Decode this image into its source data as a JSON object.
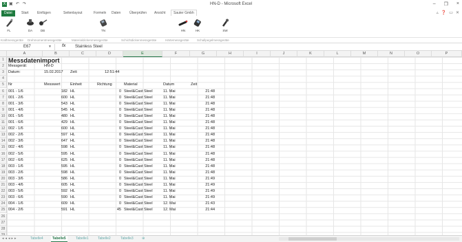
{
  "window": {
    "title": "HN-D - Microsoft Excel",
    "controls": [
      "–",
      "❐",
      "×"
    ]
  },
  "ribbon": {
    "tabs": [
      "Datei",
      "Start",
      "Einfügen",
      "Seitenlayout",
      "Formeln",
      "Daten",
      "Überprüfen",
      "Ansicht",
      "Sauter Gmbh"
    ],
    "buttons": [
      "FL",
      "DA",
      "DB",
      "TN",
      "HN",
      "HK",
      "SW"
    ],
    "groups": [
      "Kraftmessgeräte",
      "Drehmomentmessgeräte",
      "Materialdickenmessgeräte",
      "Schichtdickenmessgeräte",
      "Härtemessgeräte",
      "Schallpegelmessgeräte"
    ]
  },
  "formula_bar": {
    "namebox": "E67",
    "fx": "fx",
    "content": "Stainless Steel"
  },
  "columns": [
    "A",
    "B",
    "C",
    "D",
    "E",
    "F",
    "G",
    "H",
    "I",
    "J",
    "K",
    "L",
    "M",
    "N",
    "O",
    "P"
  ],
  "sheet": {
    "title": "Messdatenimport",
    "device_label": "Messgerät:",
    "device": "HN-D",
    "date_label": "Datum:",
    "date": "15.02.2017",
    "time_label": "Zeit:",
    "time": "12:51:44",
    "headers": [
      "Nr",
      "Messwert",
      "Einheit",
      "Richtung",
      "Material",
      "Datum",
      "Zeit"
    ],
    "rows": [
      [
        "001 - 1/6",
        "182",
        "HL",
        "0",
        "Steel&Cast Steel",
        "11. Mai",
        "21:48"
      ],
      [
        "001 - 2/6",
        "600",
        "HL",
        "0",
        "Steel&Cast Steel",
        "11. Mai",
        "21:48"
      ],
      [
        "001 - 3/6",
        "543",
        "HL",
        "0",
        "Steel&Cast Steel",
        "11. Mai",
        "21:48"
      ],
      [
        "001 - 4/6",
        "545",
        "HL",
        "0",
        "Steel&Cast Steel",
        "11. Mai",
        "21:48"
      ],
      [
        "001 - 5/6",
        "480",
        "HL",
        "0",
        "Steel&Cast Steel",
        "11. Mai",
        "21:48"
      ],
      [
        "001 - 6/6",
        "429",
        "HL",
        "0",
        "Steel&Cast Steel",
        "11. Mai",
        "21:48"
      ],
      [
        "002 - 1/6",
        "600",
        "HL",
        "0",
        "Steel&Cast Steel",
        "11. Mai",
        "21:48"
      ],
      [
        "002 - 2/6",
        "597",
        "HL",
        "0",
        "Steel&Cast Steel",
        "11. Mai",
        "21:48"
      ],
      [
        "002 - 3/6",
        "647",
        "HL",
        "0",
        "Steel&Cast Steel",
        "11. Mai",
        "21:48"
      ],
      [
        "002 - 4/6",
        "598",
        "HL",
        "0",
        "Steel&Cast Steel",
        "11. Mai",
        "21:48"
      ],
      [
        "002 - 5/6",
        "595",
        "HL",
        "0",
        "Steel&Cast Steel",
        "11. Mai",
        "21:48"
      ],
      [
        "002 - 6/6",
        "625",
        "HL",
        "0",
        "Steel&Cast Steel",
        "11. Mai",
        "21:48"
      ],
      [
        "003 - 1/6",
        "595",
        "HL",
        "0",
        "Steel&Cast Steel",
        "11. Mai",
        "21:48"
      ],
      [
        "003 - 2/6",
        "598",
        "HL",
        "0",
        "Steel&Cast Steel",
        "11. Mai",
        "21:48"
      ],
      [
        "003 - 3/6",
        "586",
        "HL",
        "0",
        "Steel&Cast Steel",
        "11. Mai",
        "21:49"
      ],
      [
        "003 - 4/6",
        "605",
        "HL",
        "0",
        "Steel&Cast Steel",
        "11. Mai",
        "21:49"
      ],
      [
        "003 - 5/6",
        "592",
        "HL",
        "0",
        "Steel&Cast Steel",
        "11. Mai",
        "21:49"
      ],
      [
        "003 - 6/6",
        "590",
        "HL",
        "0",
        "Steel&Cast Steel",
        "11. Mai",
        "21:49"
      ],
      [
        "004 - 1/6",
        "609",
        "HL",
        "0",
        "Steel&Cast Steel",
        "12. Mai",
        "21:43"
      ],
      [
        "004 - 2/6",
        "591",
        "HL",
        "45",
        "Steel&Cast Steel",
        "12. Mai",
        "21:44"
      ]
    ]
  },
  "sheet_tabs": [
    "Tabelle4",
    "Tabelle5",
    "Tabelle1",
    "Tabelle2",
    "Tabelle3"
  ],
  "active_sheet": "Tabelle5"
}
